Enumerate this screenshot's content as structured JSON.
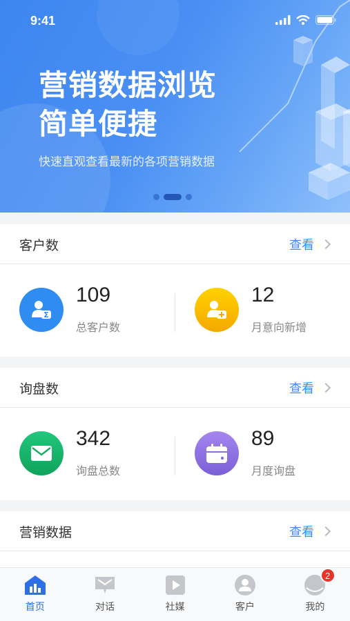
{
  "status": {
    "time": "9:41"
  },
  "banner": {
    "title_line1": "营销数据浏览",
    "title_line2": "简单便捷",
    "subtitle": "快速直观查看最新的各项营销数据",
    "page_count": 3,
    "active_page": 2
  },
  "sections": {
    "customers": {
      "title": "客户数",
      "view_label": "查看",
      "stats": [
        {
          "value": "109",
          "label": "总客户数",
          "icon": "customer-sum-icon",
          "color": "#2f8cf0"
        },
        {
          "value": "12",
          "label": "月意向新增",
          "icon": "customer-add-icon",
          "color": "#f7b500"
        }
      ]
    },
    "inquiries": {
      "title": "询盘数",
      "view_label": "查看",
      "stats": [
        {
          "value": "342",
          "label": "询盘总数",
          "icon": "mail-icon",
          "color": "#18b56d"
        },
        {
          "value": "89",
          "label": "月度询盘",
          "icon": "calendar-icon",
          "color": "#8c6fe0"
        }
      ]
    },
    "marketing": {
      "title": "营销数据",
      "view_label": "查看"
    }
  },
  "tabbar": {
    "items": [
      {
        "label": "首页",
        "icon": "home-chart-icon",
        "active": true
      },
      {
        "label": "对话",
        "icon": "chat-icon",
        "active": false
      },
      {
        "label": "社媒",
        "icon": "play-icon",
        "active": false
      },
      {
        "label": "客户",
        "icon": "person-icon",
        "active": false
      },
      {
        "label": "我的",
        "icon": "profile-icon",
        "active": false,
        "badge": "2"
      }
    ]
  },
  "colors": {
    "accent": "#3b8ef0",
    "tab_active": "#2f6fe6",
    "badge": "#e8332b"
  }
}
